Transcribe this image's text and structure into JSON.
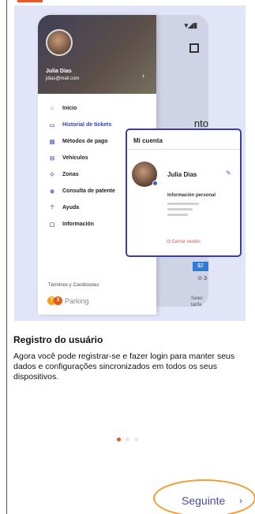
{
  "illustration": {
    "drawer": {
      "user_name": "Julia Dias",
      "user_email": "jdias@mail.com",
      "menu": [
        {
          "icon": "home-icon",
          "glyph": "⌂",
          "label": "Inicio",
          "active": false
        },
        {
          "icon": "ticket-icon",
          "glyph": "▭",
          "label": "Historial de tickets",
          "active": true
        },
        {
          "icon": "payment-icon",
          "glyph": "▤",
          "label": "Métodos de pago",
          "active": false
        },
        {
          "icon": "car-icon",
          "glyph": "⊟",
          "label": "Vehiculos",
          "active": false
        },
        {
          "icon": "zones-icon",
          "glyph": "⬦",
          "label": "Zonas",
          "active": false
        },
        {
          "icon": "plate-icon",
          "glyph": "⊕",
          "label": "Consulta de patente",
          "active": false
        },
        {
          "icon": "help-icon",
          "glyph": "?",
          "label": "Ayuda",
          "active": false
        },
        {
          "icon": "info-icon",
          "glyph": "▢",
          "label": "Información",
          "active": false
        }
      ],
      "terms": "Términos y Condiciones",
      "brand_letters": [
        "T",
        "2"
      ],
      "brand_name": "Parking"
    },
    "background_screen": {
      "peek_text": "nto",
      "chip_text": "$2",
      "small_text": "⊙ 3",
      "small_text2": "Selec tarifa"
    },
    "account_card": {
      "title": "Mi cuenta",
      "name": "Julia Dias",
      "info_label": "Información personal",
      "logout_label": "Cerrar sesión"
    }
  },
  "onboarding": {
    "heading": "Registro do usuário",
    "description": "Agora você pode registrar-se e fazer login para manter seus dados e configurações sincronizados em todos os seus dispositivos.",
    "page_count": 3,
    "active_page": 0,
    "next_label": "Seguinte",
    "next_chevron": "›"
  }
}
